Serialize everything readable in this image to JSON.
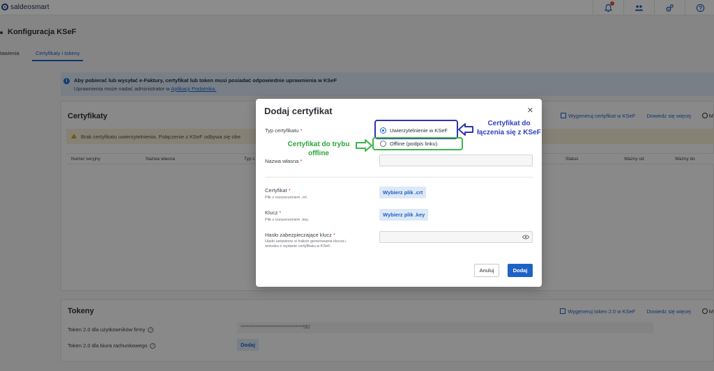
{
  "topbar": {
    "logo_text": "saldeosmart",
    "icons": [
      "bell-icon",
      "users-icon",
      "settings-icon",
      "help-icon"
    ]
  },
  "page": {
    "title": "Konfiguracja KSeF",
    "tabs": [
      {
        "label": "tawienia",
        "active": false
      },
      {
        "label": "Certyfikaty i tokeny",
        "active": true
      }
    ]
  },
  "info_banner": {
    "line1": "Aby pobierać lub wysyłać e-Faktury, certyfikat lub token musi posiadać odpowiednie uprawnienia w KSeF",
    "line2_prefix": "Uprawnienia może nadać administrator w ",
    "line2_link": "Aplikacji Podatnika."
  },
  "certificates": {
    "title": "Certyfikaty",
    "generate_link": "Wygeneruj certyfikat w KSeF",
    "learn_more_link": "Dowiedz się więcej",
    "more_label": "M",
    "warning": "Brak certyfikatu uwierzytelnienia. Połączenie z KSeF odbywa się obe",
    "columns": [
      "Numer seryjny",
      "Nazwa własna",
      "Typ c",
      "Status",
      "Ważny od",
      "Ważny do"
    ]
  },
  "tokens": {
    "title": "Tokeny",
    "generate_link": "Wygeneruj token 2.0 w KSeF",
    "learn_more_link": "Dowiedz się więcej",
    "more_label": "M",
    "row1_label": "Token 2.0 dla użytkowników firmy",
    "row1_value": "*********************************5f2",
    "row2_label": "Token 2.0 dla biura rachunkowego",
    "row2_button": "Dodaj"
  },
  "modal": {
    "title": "Dodaj certyfikat",
    "type_label": "Typ certyfikatu",
    "type_options": [
      {
        "label": "Uwierzytelnienie w KSeF",
        "selected": true
      },
      {
        "label": "Offline (podpis linku)",
        "selected": false
      }
    ],
    "name_label": "Nazwa własna",
    "name_value": "",
    "cert_label": "Certyfikat",
    "cert_sub": "Plik z rozszerzeniem .crt.",
    "cert_button": "Wybierz plik .crt",
    "key_label": "Klucz",
    "key_sub": "Plik z rozszerzeniem .key.",
    "key_button": "Wybierz plik .key",
    "password_label": "Hasło zabezpieczające klucz",
    "password_sub_1": "Hasło ustawione w trakcie generowania klucza i",
    "password_sub_2": "wniosku o wydanie certyfikatu w KSeF.",
    "cancel_button": "Anuluj",
    "submit_button": "Dodaj"
  },
  "annotations": {
    "blue_text_1": "Certyfikat do",
    "blue_text_2": "łączenia się z KSeF",
    "green_text_1": "Certyfikat do trybu",
    "green_text_2": "offline",
    "blue_color": "#2f3fc4",
    "green_color": "#2aa63a"
  },
  "colors": {
    "accent": "#1e62c6",
    "info_bg": "#dde8f6",
    "warning_bg": "#f3ecd6",
    "required": "#d13b3b"
  }
}
